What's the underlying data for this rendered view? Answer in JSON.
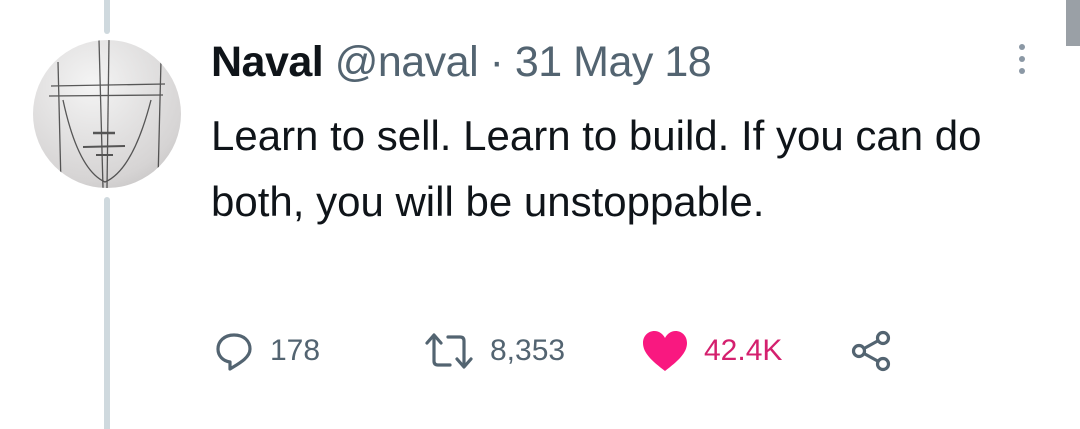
{
  "tweet": {
    "display_name": "Naval",
    "handle": "@naval",
    "separator": "·",
    "date": "31 May 18",
    "text": "Learn to sell. Learn to build. If you can do both, you will be unstoppable.",
    "replies": "178",
    "retweets": "8,353",
    "likes": "42.4K",
    "liked": true
  },
  "colors": {
    "like": "#f91880",
    "muted": "#536471",
    "thread": "#cfd9de"
  },
  "icons": [
    "reply-icon",
    "retweet-icon",
    "heart-icon",
    "share-icon",
    "more-icon"
  ]
}
